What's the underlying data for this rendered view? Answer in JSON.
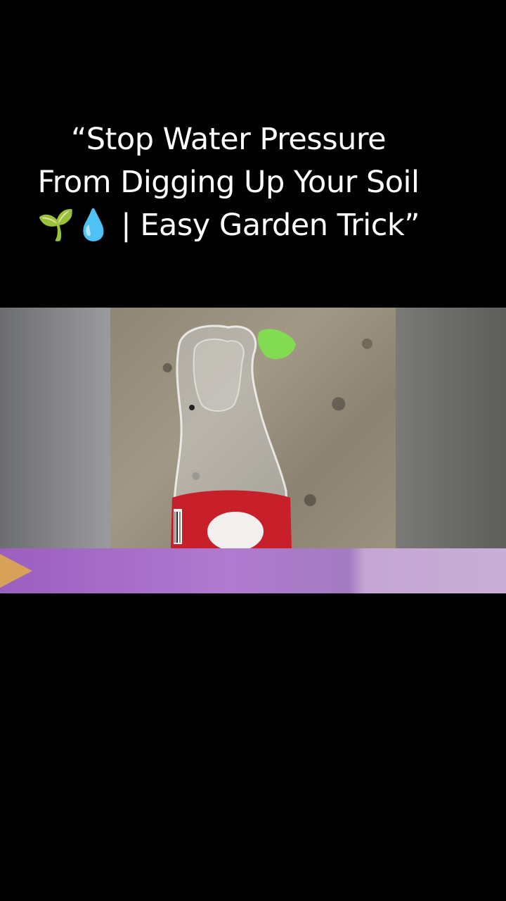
{
  "caption": {
    "line1": "“Stop Water Pressure",
    "line2": "From Digging Up Your Soil",
    "line3": "🌱💧 | Easy Garden Trick”"
  },
  "colors": {
    "background": "#000000",
    "caption_text": "#ffffff",
    "band_purple": "#a56ac7",
    "arrow": "#d8a15a",
    "bottle_label_red": "#c8202a",
    "leaf_green": "#7ee24a"
  },
  "icons": {
    "seedling": "seedling-emoji",
    "droplet": "droplet-emoji"
  }
}
